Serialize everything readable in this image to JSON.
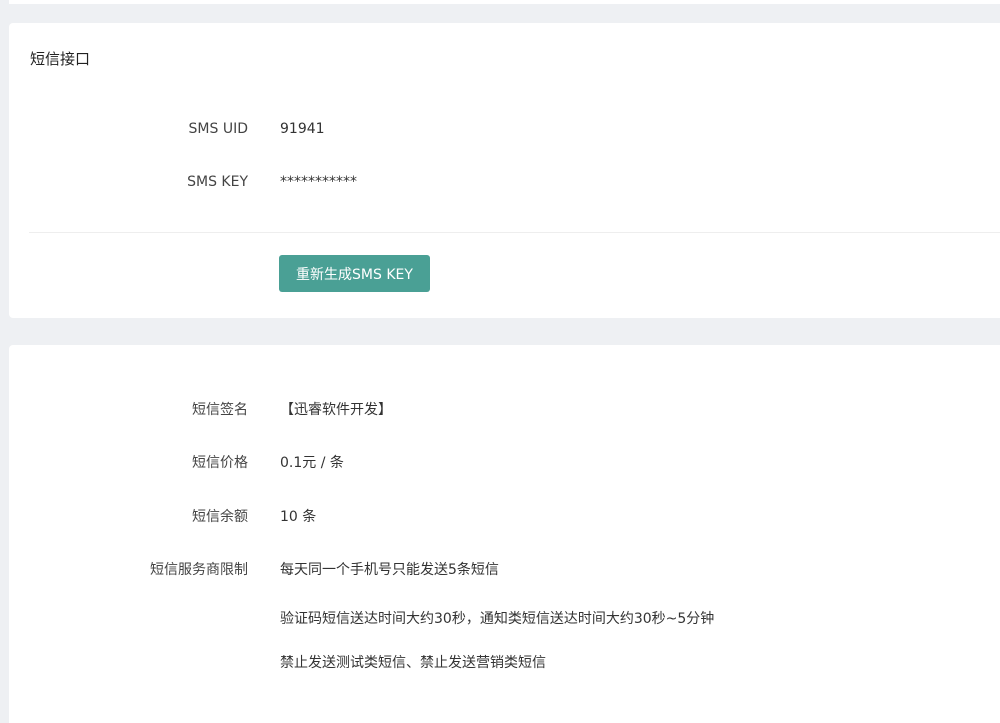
{
  "sms_interface": {
    "title": "短信接口",
    "uid_label": "SMS UID",
    "uid_value": "91941",
    "key_label": "SMS KEY",
    "key_value": "***********",
    "regenerate_button": "重新生成SMS KEY"
  },
  "sms_info": {
    "signature_label": "短信签名",
    "signature_value": "【迅睿软件开发】",
    "price_label": "短信价格",
    "price_value": "0.1元 / 条",
    "balance_label": "短信余额",
    "balance_value": "10 条",
    "limit_label": "短信服务商限制",
    "limits": [
      "每天同一个手机号只能发送5条短信",
      "验证码短信送达时间大约30秒，通知类短信送达时间大约30秒~5分钟",
      "禁止发送测试类短信、禁止发送营销类短信"
    ]
  },
  "colors": {
    "background": "#eef0f3",
    "card": "#ffffff",
    "primary_button": "#4aa095"
  }
}
